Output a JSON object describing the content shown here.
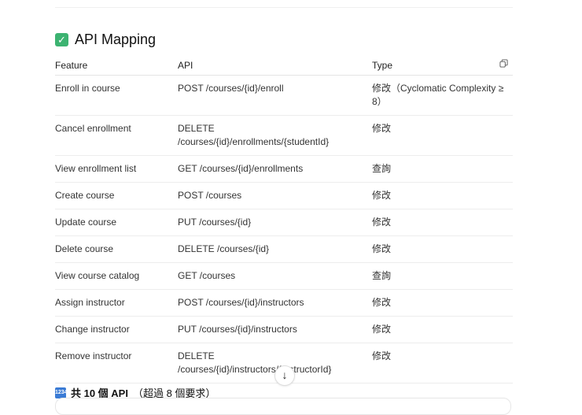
{
  "section_title": "API Mapping",
  "headers": {
    "feature": "Feature",
    "api": "API",
    "type": "Type"
  },
  "rows": [
    {
      "feature": "Enroll in course",
      "api": "POST /courses/{id}/enroll",
      "type": "修改（Cyclomatic Complexity ≥ 8）"
    },
    {
      "feature": "Cancel enrollment",
      "api": "DELETE /courses/{id}/enrollments/{studentId}",
      "type": "修改"
    },
    {
      "feature": "View enrollment list",
      "api": "GET /courses/{id}/enrollments",
      "type": "查詢"
    },
    {
      "feature": "Create course",
      "api": "POST /courses",
      "type": "修改"
    },
    {
      "feature": "Update course",
      "api": "PUT /courses/{id}",
      "type": "修改"
    },
    {
      "feature": "Delete course",
      "api": "DELETE /courses/{id}",
      "type": "修改"
    },
    {
      "feature": "View course catalog",
      "api": "GET /courses",
      "type": "查詢"
    },
    {
      "feature": "Assign instructor",
      "api": "POST /courses/{id}/instructors",
      "type": "修改"
    },
    {
      "feature": "Change instructor",
      "api": "PUT /courses/{id}/instructors",
      "type": "修改"
    },
    {
      "feature": "Remove instructor",
      "api": "DELETE /courses/{id}/instructors/{instructorId}",
      "type": "修改"
    }
  ],
  "summary": {
    "main": "共 10 個 API",
    "note": "（超過 8 個要求）"
  },
  "icons": {
    "title": "check-mark-button-icon",
    "copy": "copy-icon",
    "scroll": "arrow-down-icon",
    "summary": "numbers-icon"
  }
}
